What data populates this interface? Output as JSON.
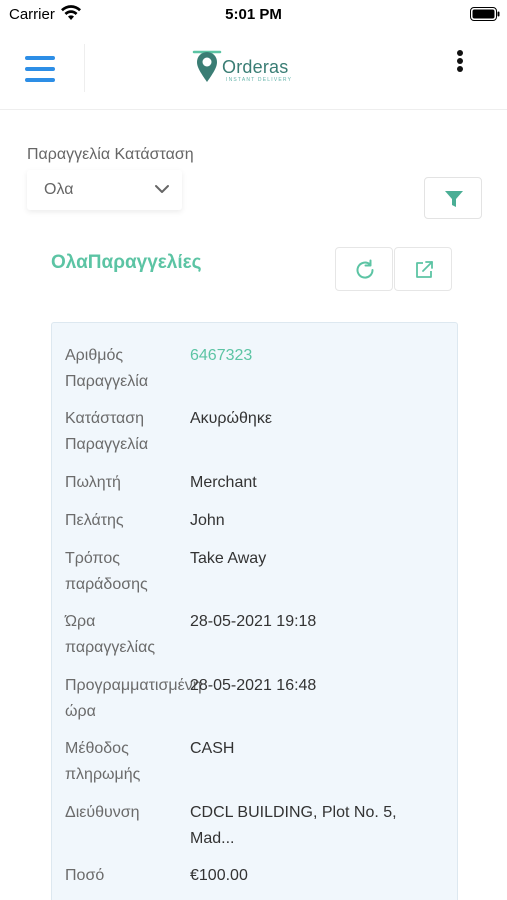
{
  "status_bar": {
    "carrier": "Carrier",
    "time": "5:01 PM"
  },
  "header": {
    "logo_text": "Orderas",
    "logo_subtitle": "INSTANT DELIVERY",
    "menu_icon": "hamburger-icon",
    "more_icon": "more-vertical-icon"
  },
  "filter": {
    "label": "Παραγγελία Κατάσταση",
    "selected_status": "Ολα",
    "filter_icon": "funnel-icon"
  },
  "section": {
    "title": "ΟλαΠαραγγελίες",
    "refresh_icon": "refresh-icon",
    "export_icon": "external-link-icon"
  },
  "order": {
    "rows": [
      {
        "label": "Αριθμός\nΠαραγγελία",
        "value": "6467323"
      },
      {
        "label": "Κατάσταση\nΠαραγγελία",
        "value": "Ακυρώθηκε"
      },
      {
        "label": "Πωλητή",
        "value": "Merchant"
      },
      {
        "label": "Πελάτης",
        "value": "John"
      },
      {
        "label": "Τρόπος\nπαράδοσης",
        "value": "Take Away"
      },
      {
        "label": "Ώρα\nπαραγγελίας",
        "value": "28-05-2021 19:18"
      },
      {
        "label": "Προγραμματισμένη\nώρα",
        "value": "28-05-2021 16:48"
      },
      {
        "label": "Μέθοδος\nπληρωμής",
        "value": "CASH"
      },
      {
        "label": "Διεύθυνση",
        "value": "CDCL BUILDING, Plot No. 5,\nMad..."
      },
      {
        "label": "Ποσό",
        "value": "€100.00"
      }
    ]
  },
  "colors": {
    "accent_green": "#5cc4a4",
    "menu_blue": "#2d8ee6",
    "card_background": "#f1f7fc"
  }
}
